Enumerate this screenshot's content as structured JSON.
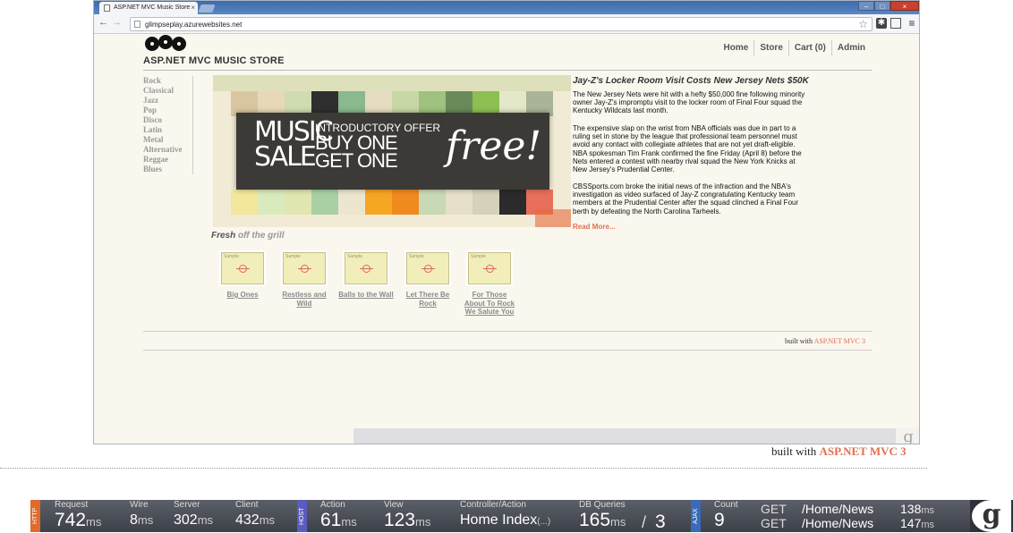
{
  "browser": {
    "tab_title": "ASP.NET MVC Music Store",
    "tab_close": "×",
    "url": "glimpseplay.azurewebsites.net",
    "back": "←",
    "forward": "→",
    "reload": "↻",
    "star": "☆",
    "menu": "≡",
    "win_min": "–",
    "win_max": "□",
    "win_close": "×"
  },
  "store": {
    "title": "ASP.NET MVC MUSIC STORE",
    "nav": [
      "Home",
      "Store",
      "Cart (0)",
      "Admin"
    ],
    "genres": [
      "Rock",
      "Classical",
      "Jazz",
      "Pop",
      "Disco",
      "Latin",
      "Metal",
      "Alternative",
      "Reggae",
      "Blues"
    ],
    "banner": {
      "music": "MUSIC",
      "sale": "SALE",
      "offer": "INTRODUCTORY OFFER",
      "buy": "BUY ONE",
      "get": "GET ONE",
      "free": "free!"
    },
    "news": {
      "title": "Jay-Z's Locker Room Visit Costs New Jersey Nets $50K",
      "p1": "The New Jersey Nets were hit with a hefty $50,000 fine following minority owner Jay-Z's impromptu visit to the locker room of Final Four squad the Kentucky Wildcats last month.",
      "p2": "The expensive slap on the wrist from NBA officials was due in part to a ruling set in stone by the league that professional team personnel must avoid any contact with collegiate athletes that are not yet draft-eligible. NBA spokesman Tim Frank confirmed the fine Friday (April 8) before the Nets entered a contest with nearby rival squad the New York Knicks at New Jersey's Prudential Center.",
      "p3": "CBSSports.com broke the initial news of the infraction and the NBA's investigation as video surfaced of Jay-Z congratulating Kentucky team members at the Prudential Center after the squad clinched a Final Four berth by defeating the North Carolina Tarheels.",
      "read_more": "Read More..."
    },
    "fresh": {
      "main": "Fresh",
      "sub": "off the grill"
    },
    "sample_label": "Sample",
    "albums": [
      "Big Ones",
      "Restless and Wild",
      "Balls to the Wall",
      "Let There Be Rock",
      "For Those About To Rock We Salute You"
    ],
    "built_with": "built with",
    "built_brand": "ASP.NET MVC 3"
  },
  "footer": {
    "built_with": "built with",
    "built_brand": "ASP.NET MVC 3"
  },
  "glimpse": {
    "tags": {
      "http": "HTTP",
      "host": "HOST",
      "ajax": "AJAX"
    },
    "unit": "ms",
    "request": {
      "label": "Request",
      "value": "742"
    },
    "wire": {
      "label": "Wire",
      "value": "8"
    },
    "server": {
      "label": "Server",
      "value": "302"
    },
    "client": {
      "label": "Client",
      "value": "432"
    },
    "action": {
      "label": "Action",
      "value": "61"
    },
    "view": {
      "label": "View",
      "value": "123"
    },
    "controller": {
      "label": "Controller/Action",
      "value": "Home Index",
      "more": "(...)"
    },
    "db": {
      "label": "DB Queries",
      "value": "165",
      "count": "3",
      "sep": "/"
    },
    "ajax_count": {
      "label": "Count",
      "value": "9"
    },
    "ajax_rows": [
      {
        "method": "GET",
        "path": "/Home/News",
        "time": "138"
      },
      {
        "method": "GET",
        "path": "/Home/News",
        "time": "147"
      }
    ],
    "logo": "g"
  }
}
